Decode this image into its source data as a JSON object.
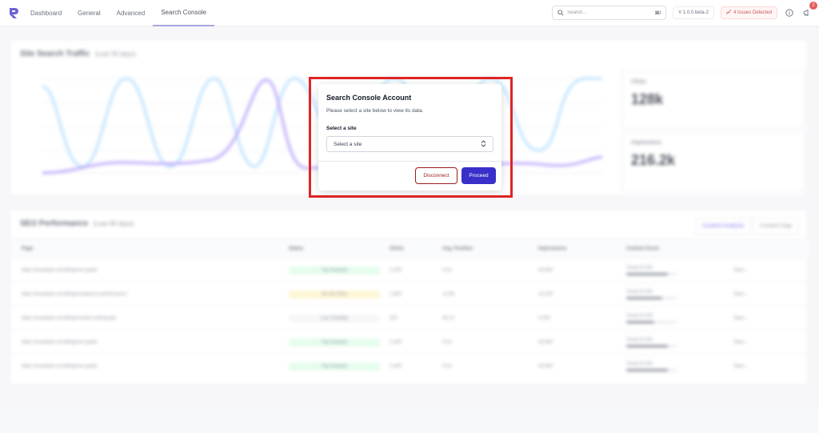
{
  "nav": {
    "items": [
      {
        "label": "Dashboard"
      },
      {
        "label": "General"
      },
      {
        "label": "Advanced"
      },
      {
        "label": "Search Console"
      }
    ]
  },
  "header": {
    "search_placeholder": "Search...",
    "shortcut": "⌘/",
    "version": "V 1.0.0.beta-2",
    "issues": "4 Issues Detected",
    "notification_count": "2"
  },
  "traffic": {
    "title": "Site Search Traffic",
    "subtitle": "(Last 30 days)",
    "stats": [
      {
        "label": "Clicks",
        "value": "128k"
      },
      {
        "label": "Impressions",
        "value": "216.2k"
      }
    ]
  },
  "seo": {
    "title": "SEO Performance",
    "subtitle": "(Last 90 days)",
    "tabs": [
      "Content Analysis",
      "Content Gap"
    ],
    "columns": [
      "Page",
      "Status",
      "Clicks",
      "Avg. Position",
      "Impressions",
      "Content Score",
      ""
    ],
    "rows": [
      {
        "page": "https://example.com/blog/seo-guide",
        "status": "Top Ranked",
        "tone": "green",
        "clicks": "2,400",
        "pos": "3.24",
        "imp": "28,400",
        "score_text": "Good of 100",
        "score": 0.82,
        "action": "View"
      },
      {
        "page": "https://example.com/blog/wordpress-performance",
        "status": "On the Rise",
        "tone": "yellow",
        "clicks": "1,800",
        "pos": "12.66",
        "imp": "14,200",
        "score_text": "Good of 100",
        "score": 0.7,
        "action": "View"
      },
      {
        "page": "https://example.com/blog/content-writing-tips",
        "status": "Low Visibility",
        "tone": "gray",
        "clicks": "320",
        "pos": "38.12",
        "imp": "4,200",
        "score_text": "Good of 100",
        "score": 0.55,
        "action": "View"
      },
      {
        "page": "https://example.com/blog/seo-guide",
        "status": "Top Ranked",
        "tone": "green",
        "clicks": "2,400",
        "pos": "3.24",
        "imp": "28,400",
        "score_text": "Good of 100",
        "score": 0.82,
        "action": "View"
      },
      {
        "page": "https://example.com/blog/seo-guide",
        "status": "Top Ranked",
        "tone": "green",
        "clicks": "2,400",
        "pos": "3.24",
        "imp": "28,400",
        "score_text": "Good of 100",
        "score": 0.82,
        "action": "View"
      }
    ]
  },
  "modal": {
    "title": "Search Console Account",
    "description": "Please select a site below to view its data.",
    "field_label": "Select a site",
    "select_value": "Select a site",
    "disconnect_label": "Disconnect",
    "proceed_label": "Proceed"
  },
  "colors": {
    "accent": "#3b2fc9",
    "danger": "#9b1c1c",
    "highlight": "#e02424"
  }
}
